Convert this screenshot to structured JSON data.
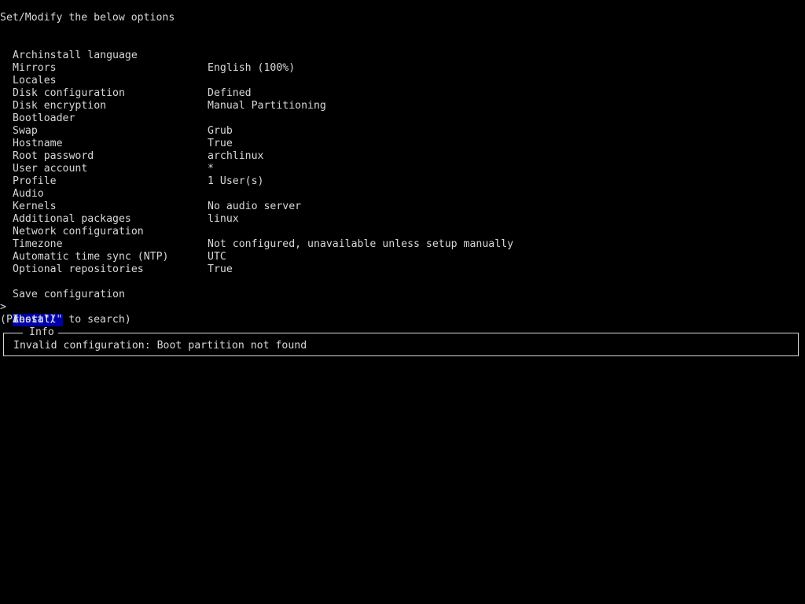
{
  "header": {
    "title": "Set/Modify the below options"
  },
  "menu": {
    "cursor": ">",
    "options": [
      {
        "label": "Archinstall language",
        "value": "English (100%)"
      },
      {
        "label": "Mirrors",
        "value": ""
      },
      {
        "label": "Locales",
        "value": "Defined"
      },
      {
        "label": "Disk configuration",
        "value": "Manual Partitioning"
      },
      {
        "label": "Disk encryption",
        "value": ""
      },
      {
        "label": "Bootloader",
        "value": "Grub"
      },
      {
        "label": "Swap",
        "value": "True"
      },
      {
        "label": "Hostname",
        "value": "archlinux"
      },
      {
        "label": "Root password",
        "value": "*"
      },
      {
        "label": "User account",
        "value": "1 User(s)"
      },
      {
        "label": "Profile",
        "value": ""
      },
      {
        "label": "Audio",
        "value": "No audio server"
      },
      {
        "label": "Kernels",
        "value": "linux"
      },
      {
        "label": "Additional packages",
        "value": ""
      },
      {
        "label": "Network configuration",
        "value": "Not configured, unavailable unless setup manually"
      },
      {
        "label": "Timezone",
        "value": "UTC"
      },
      {
        "label": "Automatic time sync (NTP)",
        "value": "True"
      },
      {
        "label": "Optional repositories",
        "value": ""
      }
    ],
    "actions": [
      {
        "label": "Save configuration",
        "selected": false
      },
      {
        "label": "Install",
        "selected": true
      },
      {
        "label": "Abort",
        "selected": false
      }
    ]
  },
  "search_hint": "(Press \"/\" to search)",
  "info": {
    "title": "Info",
    "message": "Invalid configuration: Boot partition not found"
  },
  "colors": {
    "background": "#000000",
    "text": "#d8d8d8",
    "highlight_bg": "#0000aa",
    "highlight_text": "#ffffff"
  }
}
